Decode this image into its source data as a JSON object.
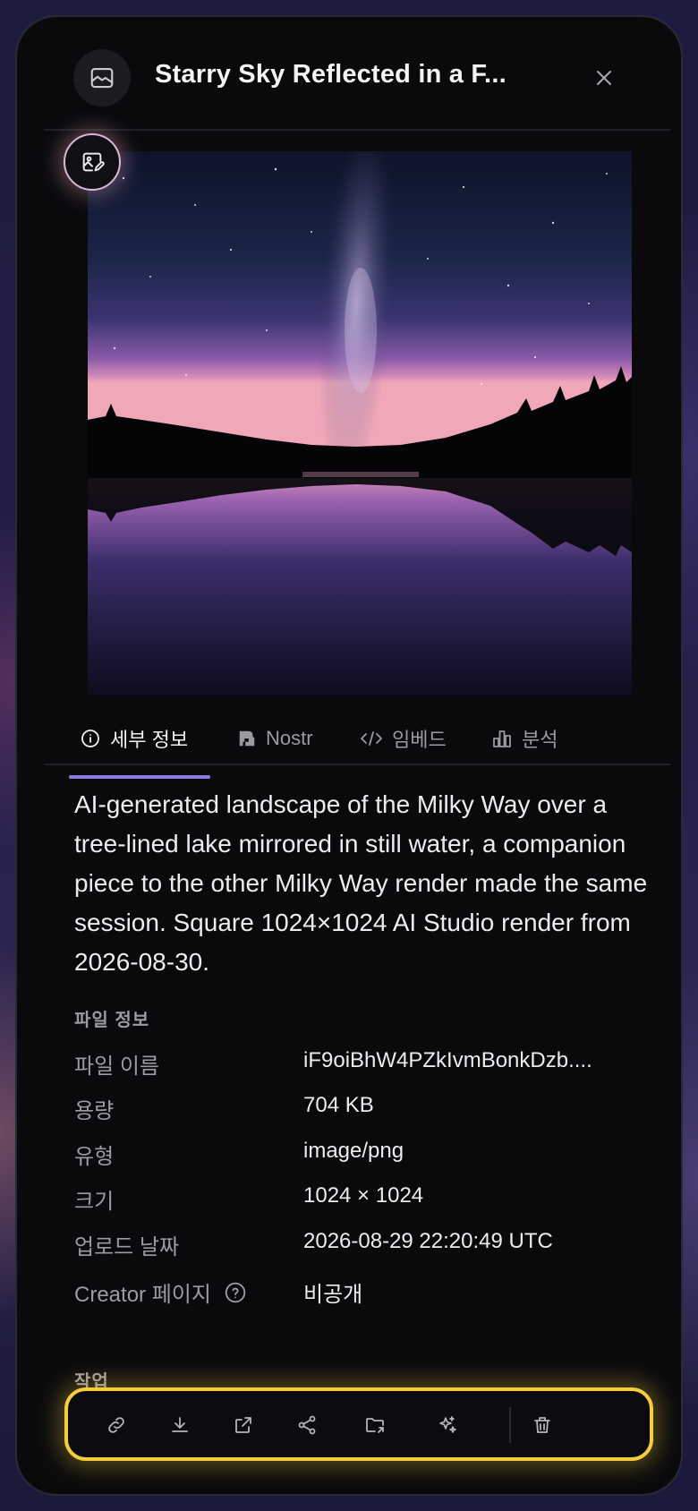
{
  "header": {
    "title": "Starry Sky Reflected in a F...",
    "image_icon": "image-icon",
    "close_icon": "close-icon"
  },
  "image": {
    "edit_icon": "image-edit-icon"
  },
  "tabs": [
    {
      "label": "세부 정보",
      "icon": "info-icon",
      "active": true
    },
    {
      "label": "Nostr",
      "icon": "nostr-icon",
      "active": false
    },
    {
      "label": "임베드",
      "icon": "code-icon",
      "active": false
    },
    {
      "label": "분석",
      "icon": "bar-chart-icon",
      "active": false
    }
  ],
  "description": "AI-generated landscape of the Milky Way over a tree-lined lake mirrored in still water, a companion piece to the other Milky Way render made the same session. Square 1024×1024 AI Studio render from 2026-08-30.",
  "file_info": {
    "heading": "파일 정보",
    "rows": [
      {
        "label": "파일 이름",
        "value": "iF9oiBhW4PZkIvmBonkDzb...."
      },
      {
        "label": "용량",
        "value": "704 KB"
      },
      {
        "label": "유형",
        "value": "image/png"
      },
      {
        "label": "크기",
        "value": "1024 × 1024"
      },
      {
        "label": "업로드 날짜",
        "value": "2026-08-29 22:20:49 UTC"
      },
      {
        "label": "Creator 페이지",
        "value": "비공개",
        "help_icon": "help-circle-icon"
      }
    ]
  },
  "actions": {
    "heading": "작업",
    "items": [
      "link-icon",
      "download-icon",
      "external-link-icon",
      "share-icon",
      "folder-move-icon",
      "sparkles-icon",
      "trash-icon"
    ]
  },
  "colors": {
    "accent": "#8b7be0",
    "highlight": "#f5cc3c",
    "panel_bg": "#0a0a0d"
  }
}
